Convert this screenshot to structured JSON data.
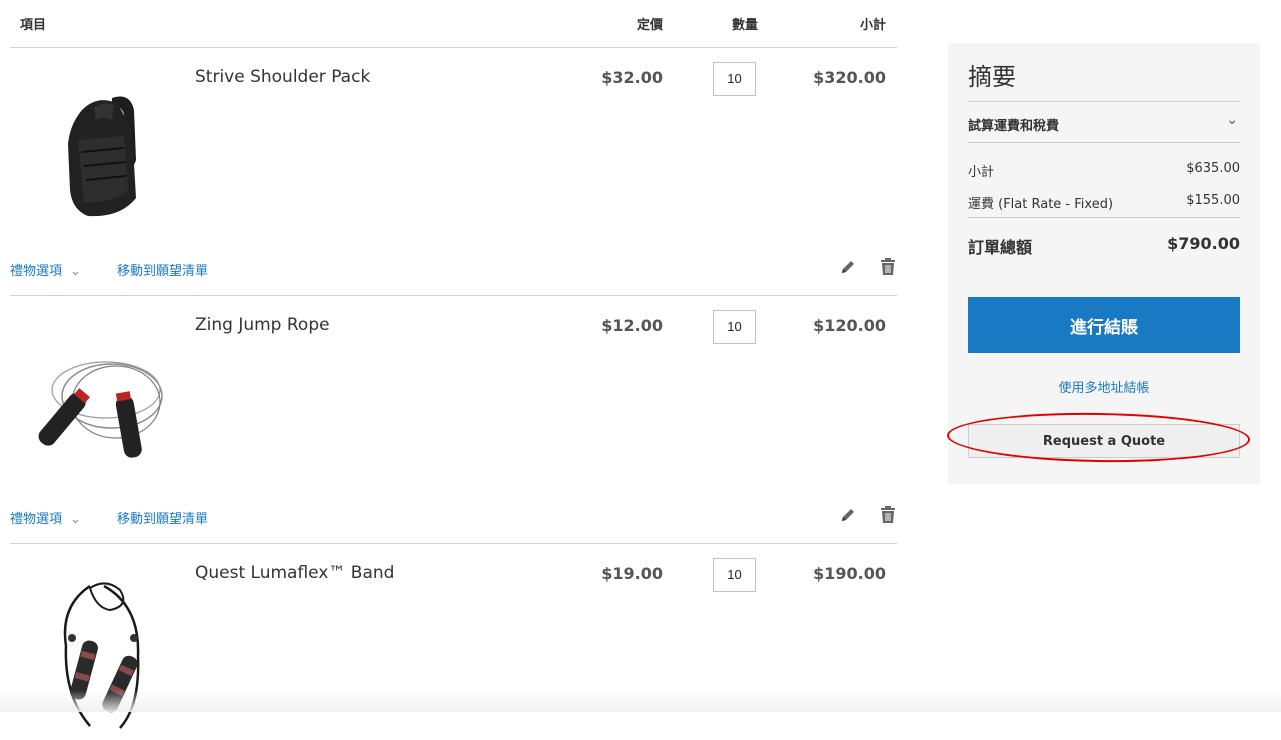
{
  "cart": {
    "headers": {
      "item": "項目",
      "price": "定價",
      "qty": "數量",
      "subtotal": "小計"
    },
    "items": [
      {
        "name": "Strive Shoulder Pack",
        "price": "$32.00",
        "qty": "10",
        "subtotal": "$320.00",
        "gift": "禮物選項",
        "wishlist": "移動到願望清單"
      },
      {
        "name": "Zing Jump Rope",
        "price": "$12.00",
        "qty": "10",
        "subtotal": "$120.00",
        "gift": "禮物選項",
        "wishlist": "移動到願望清單"
      },
      {
        "name": "Quest Lumaflex™ Band",
        "price": "$19.00",
        "qty": "10",
        "subtotal": "$190.00"
      }
    ]
  },
  "summary": {
    "title": "摘要",
    "shipping_toggle": "試算運費和稅費",
    "subtotal_label": "小計",
    "subtotal_value": "$635.00",
    "shipping_label": "運費 (Flat Rate - Fixed)",
    "shipping_value": "$155.00",
    "total_label": "訂單總額",
    "total_value": "$790.00",
    "checkout_label": "進行結賬",
    "multi_address_label": "使用多地址結帳",
    "quote_label": "Request a Quote"
  },
  "colors": {
    "link": "#1979c3",
    "primary_button": "#1979c3",
    "highlight": "#e00000"
  },
  "icons": [
    "chevron-down-icon",
    "pencil-icon",
    "trash-icon"
  ]
}
